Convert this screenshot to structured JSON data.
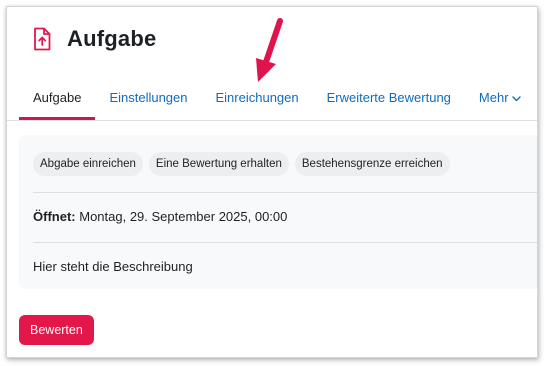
{
  "header": {
    "title": "Aufgabe",
    "icon": "assignment-upload-icon",
    "icon_color": "#e2184b"
  },
  "tabs": [
    {
      "label": "Aufgabe",
      "active": true
    },
    {
      "label": "Einstellungen",
      "active": false
    },
    {
      "label": "Einreichungen",
      "active": false
    },
    {
      "label": "Erweiterte Bewertung",
      "active": false
    },
    {
      "label": "Mehr",
      "active": false,
      "icon": "chevron-down-icon"
    }
  ],
  "activity": {
    "completion_conditions": [
      "Abgabe einreichen",
      "Eine Bewertung erhalten",
      "Bestehensgrenze erreichen"
    ],
    "dates": {
      "label": "Öffnet:",
      "value": "Montag, 29. September 2025, 00:00"
    },
    "description": "Hier steht die Beschreibung"
  },
  "actions": {
    "grade_label": "Bewerten"
  },
  "annotation": {
    "arrow_color": "#e0134d",
    "arrow_target": "Einreichungen"
  },
  "colors": {
    "accent": "#e2184b",
    "link": "#0f6cbf",
    "active_tab_underline": "#c91b4a"
  }
}
